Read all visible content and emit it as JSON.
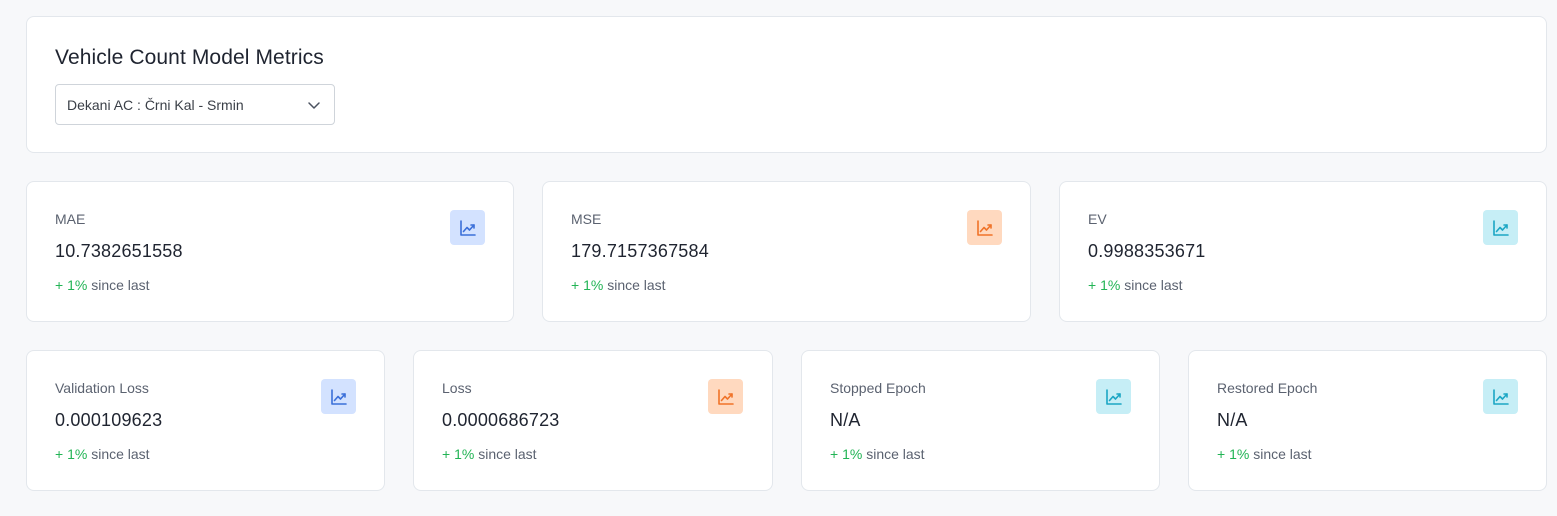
{
  "header": {
    "title": "Vehicle Count Model Metrics",
    "select": {
      "value": "Dekani AC : Črni Kal - Srmin",
      "icon": "chevron-down-icon"
    }
  },
  "metrics_row1": [
    {
      "label": "MAE",
      "value": "10.7382651558",
      "change_pct": "+ 1%",
      "change_text": "since last",
      "icon": "trending-up-icon",
      "icon_color": "#3b6fd9",
      "icon_bg": "#d3e2ff"
    },
    {
      "label": "MSE",
      "value": "179.7157367584",
      "change_pct": "+ 1%",
      "change_text": "since last",
      "icon": "trending-up-icon",
      "icon_color": "#f07329",
      "icon_bg": "#ffd9bf"
    },
    {
      "label": "EV",
      "value": "0.9988353671",
      "change_pct": "+ 1%",
      "change_text": "since last",
      "icon": "trending-up-icon",
      "icon_color": "#1ba6c4",
      "icon_bg": "#c6eef6"
    }
  ],
  "metrics_row2": [
    {
      "label": "Validation Loss",
      "value": "0.000109623",
      "change_pct": "+ 1%",
      "change_text": "since last",
      "icon": "trending-up-icon",
      "icon_color": "#3b6fd9",
      "icon_bg": "#d3e2ff"
    },
    {
      "label": "Loss",
      "value": "0.0000686723",
      "change_pct": "+ 1%",
      "change_text": "since last",
      "icon": "trending-up-icon",
      "icon_color": "#f07329",
      "icon_bg": "#ffd9bf"
    },
    {
      "label": "Stopped Epoch",
      "value": "N/A",
      "change_pct": "+ 1%",
      "change_text": "since last",
      "icon": "trending-up-icon",
      "icon_color": "#1ba6c4",
      "icon_bg": "#c6eef6"
    },
    {
      "label": "Restored Epoch",
      "value": "N/A",
      "change_pct": "+ 1%",
      "change_text": "since last",
      "icon": "trending-up-icon",
      "icon_color": "#1ba6c4",
      "icon_bg": "#c6eef6"
    }
  ],
  "colors": {
    "positive_change": "#22b455"
  }
}
